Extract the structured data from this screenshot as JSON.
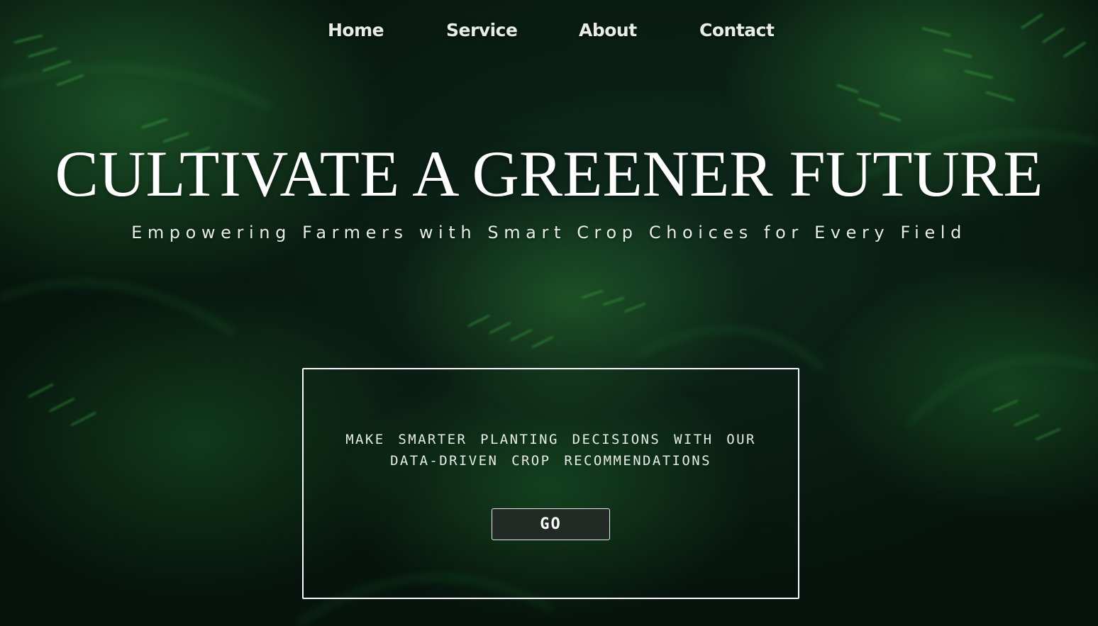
{
  "nav": {
    "items": [
      {
        "label": "Home"
      },
      {
        "label": "Service"
      },
      {
        "label": "About"
      },
      {
        "label": "Contact"
      }
    ]
  },
  "hero": {
    "headline": "CULTIVATE A GREENER FUTURE",
    "tagline": "Empowering Farmers with Smart Crop Choices for Every Field"
  },
  "cta": {
    "line1": "MAKE SMARTER PLANTING DECISIONS WITH OUR",
    "line2": "DATA-DRIVEN CROP RECOMMENDATIONS",
    "button_label": "GO"
  },
  "colors": {
    "background_dark": "#0a1e14",
    "foliage_green": "#2e8a3c",
    "text": "#ffffff",
    "button_bg": "#222a26"
  }
}
